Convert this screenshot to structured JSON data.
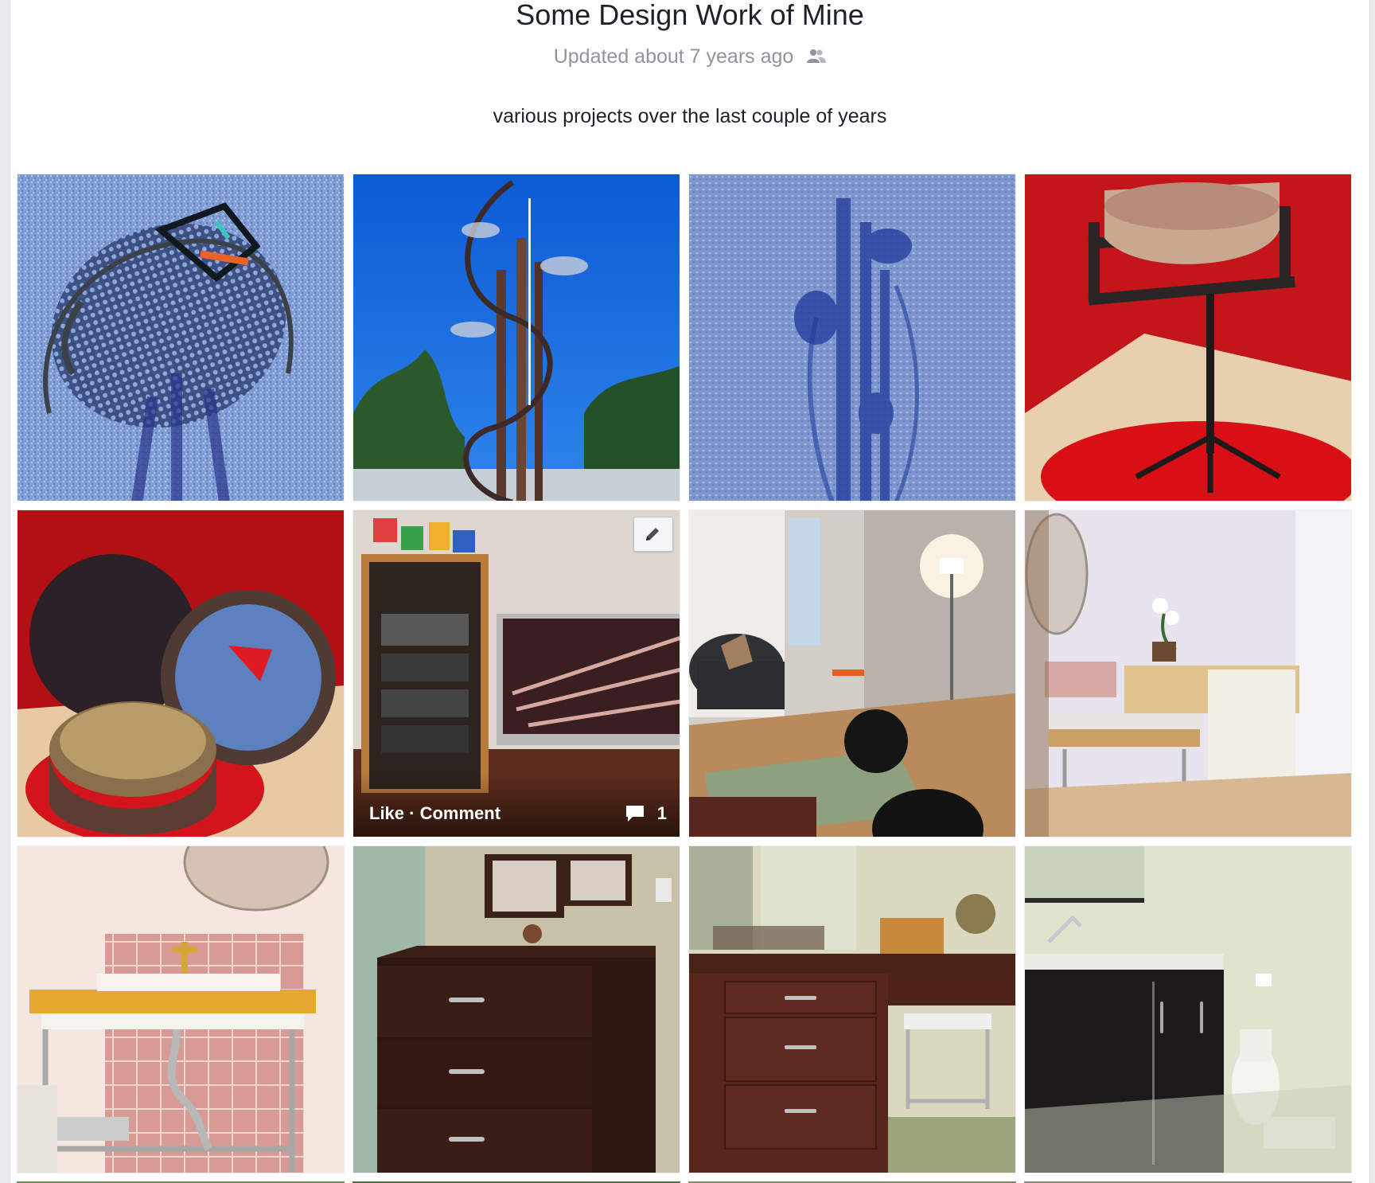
{
  "album": {
    "title": "Some Design Work of Mine",
    "updated": "Updated about 7 years ago",
    "privacy_icon": "friends-icon",
    "description": "various projects over the last couple of years"
  },
  "hover_overlay": {
    "like": "Like",
    "separator": " · ",
    "comment": "Comment",
    "comment_count": "1",
    "comment_icon": "speech-bubble-icon",
    "edit_icon": "pencil-icon"
  }
}
